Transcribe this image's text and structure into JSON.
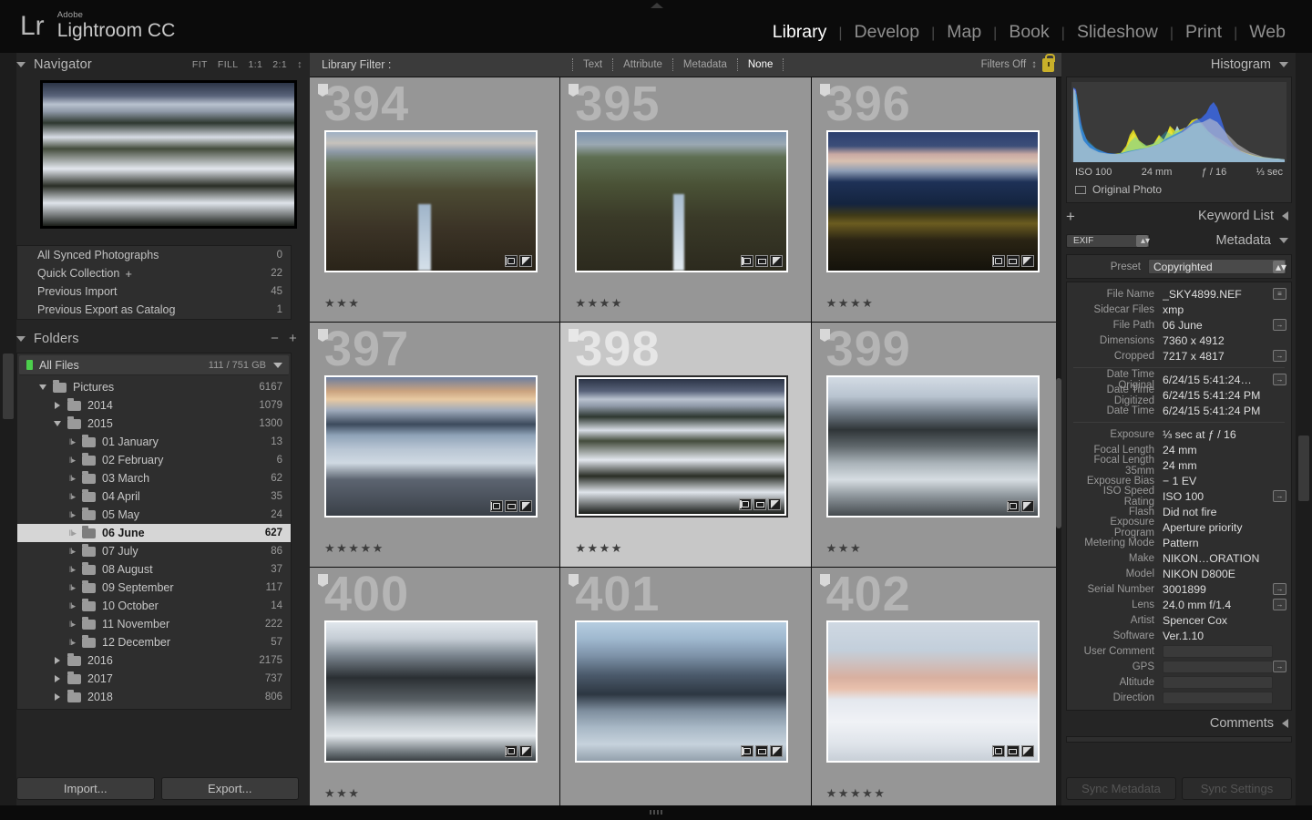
{
  "app": {
    "brand_prefix": "Lr",
    "brand_line1": "Adobe",
    "brand_line2": "Lightroom CC"
  },
  "modules": [
    {
      "label": "Library",
      "active": true
    },
    {
      "label": "Develop",
      "active": false
    },
    {
      "label": "Map",
      "active": false
    },
    {
      "label": "Book",
      "active": false
    },
    {
      "label": "Slideshow",
      "active": false
    },
    {
      "label": "Print",
      "active": false
    },
    {
      "label": "Web",
      "active": false
    }
  ],
  "navigator": {
    "title": "Navigator",
    "zoom_levels": [
      "FIT",
      "FILL",
      "1:1",
      "2:1"
    ]
  },
  "catalog": {
    "rows": [
      {
        "label": "All Synced Photographs",
        "count": "0"
      },
      {
        "label": "Quick Collection",
        "plus": "+",
        "count": "22"
      },
      {
        "label": "Previous Import",
        "count": "45"
      },
      {
        "label": "Previous Export as Catalog",
        "count": "1"
      }
    ]
  },
  "folders": {
    "title": "Folders",
    "minus": "−",
    "plus": "+",
    "volume": {
      "label": "All Files",
      "size": "111 / 751 GB"
    },
    "tree": [
      {
        "label": "Pictures",
        "count": "6167",
        "indent": 1,
        "disc": "down",
        "selected": false
      },
      {
        "label": "2014",
        "count": "1079",
        "indent": 2,
        "disc": "right",
        "selected": false
      },
      {
        "label": "2015",
        "count": "1300",
        "indent": 2,
        "disc": "down",
        "selected": false
      },
      {
        "label": "01 January",
        "count": "13",
        "indent": 3,
        "disc": "sub",
        "selected": false
      },
      {
        "label": "02 February",
        "count": "6",
        "indent": 3,
        "disc": "sub",
        "selected": false
      },
      {
        "label": "03 March",
        "count": "62",
        "indent": 3,
        "disc": "sub",
        "selected": false
      },
      {
        "label": "04 April",
        "count": "35",
        "indent": 3,
        "disc": "sub",
        "selected": false
      },
      {
        "label": "05 May",
        "count": "24",
        "indent": 3,
        "disc": "sub",
        "selected": false
      },
      {
        "label": "06 June",
        "count": "627",
        "indent": 3,
        "disc": "sub",
        "selected": true
      },
      {
        "label": "07 July",
        "count": "86",
        "indent": 3,
        "disc": "sub",
        "selected": false
      },
      {
        "label": "08 August",
        "count": "37",
        "indent": 3,
        "disc": "sub",
        "selected": false
      },
      {
        "label": "09 September",
        "count": "117",
        "indent": 3,
        "disc": "sub",
        "selected": false
      },
      {
        "label": "10 October",
        "count": "14",
        "indent": 3,
        "disc": "sub",
        "selected": false
      },
      {
        "label": "11 November",
        "count": "222",
        "indent": 3,
        "disc": "sub",
        "selected": false
      },
      {
        "label": "12 December",
        "count": "57",
        "indent": 3,
        "disc": "sub",
        "selected": false
      },
      {
        "label": "2016",
        "count": "2175",
        "indent": 2,
        "disc": "right",
        "selected": false
      },
      {
        "label": "2017",
        "count": "737",
        "indent": 2,
        "disc": "right",
        "selected": false
      },
      {
        "label": "2018",
        "count": "806",
        "indent": 2,
        "disc": "right",
        "selected": false
      }
    ]
  },
  "left_buttons": {
    "import": "Import...",
    "export": "Export..."
  },
  "library_filter": {
    "label": "Library Filter :",
    "tabs": [
      {
        "label": "Text",
        "active": false
      },
      {
        "label": "Attribute",
        "active": false
      },
      {
        "label": "Metadata",
        "active": false
      },
      {
        "label": "None",
        "active": true
      }
    ],
    "filters_off": "Filters Off"
  },
  "grid": {
    "cells": [
      {
        "number": "394",
        "stars": 3,
        "badges": [
          "crop",
          "adjust"
        ],
        "photo": "ph-canyon1",
        "selected": false
      },
      {
        "number": "395",
        "stars": 4,
        "badges": [
          "crop",
          "rect",
          "adjust"
        ],
        "photo": "ph-canyon2",
        "selected": false
      },
      {
        "number": "396",
        "stars": 4,
        "badges": [
          "crop",
          "rect",
          "adjust"
        ],
        "photo": "ph-sunset",
        "selected": false
      },
      {
        "number": "397",
        "stars": 5,
        "badges": [
          "crop",
          "rect",
          "adjust"
        ],
        "photo": "ph-snowmtn",
        "selected": false
      },
      {
        "number": "398",
        "stars": 4,
        "badges": [
          "crop",
          "rect",
          "adjust"
        ],
        "photo": "ph-snowfield",
        "selected": true
      },
      {
        "number": "399",
        "stars": 3,
        "badges": [
          "crop",
          "adjust"
        ],
        "photo": "ph-ice1",
        "selected": false
      },
      {
        "number": "400",
        "stars": 3,
        "badges": [
          "crop",
          "adjust"
        ],
        "photo": "ph-ice2",
        "selected": false
      },
      {
        "number": "401",
        "stars": 0,
        "badges": [
          "crop",
          "rect",
          "adjust"
        ],
        "photo": "ph-clouds",
        "selected": false
      },
      {
        "number": "402",
        "stars": 5,
        "badges": [
          "crop",
          "rect",
          "adjust"
        ],
        "photo": "ph-pinksnow",
        "selected": false
      }
    ]
  },
  "histogram": {
    "title": "Histogram",
    "iso": "ISO 100",
    "focal": "24 mm",
    "aperture": "ƒ / 16",
    "shutter": "⅓ sec",
    "original_photo": "Original Photo"
  },
  "keyword_list": {
    "title": "Keyword List",
    "plus": "+"
  },
  "metadata": {
    "title": "Metadata",
    "preset_mode": "EXIF",
    "preset_label": "Preset",
    "preset_value": "Copyrighted",
    "groups": [
      {
        "rows": [
          {
            "label": "File Name",
            "value": "_SKY4899.NEF",
            "action": "list"
          },
          {
            "label": "Sidecar Files",
            "value": "xmp",
            "action": "none"
          },
          {
            "label": "File Path",
            "value": "06 June",
            "action": "arrow"
          },
          {
            "label": "Dimensions",
            "value": "7360 x 4912",
            "action": "none"
          },
          {
            "label": "Cropped",
            "value": "7217 x 4817",
            "action": "arrow"
          }
        ]
      },
      {
        "rows": [
          {
            "label": "Date Time Original",
            "value": "6/24/15 5:41:24…",
            "action": "arrow"
          },
          {
            "label": "Date Time Digitized",
            "value": "6/24/15 5:41:24 PM",
            "action": "none"
          },
          {
            "label": "Date Time",
            "value": "6/24/15 5:41:24 PM",
            "action": "none"
          }
        ]
      },
      {
        "rows": [
          {
            "label": "Exposure",
            "value": "⅓ sec at ƒ / 16",
            "action": "none"
          },
          {
            "label": "Focal Length",
            "value": "24 mm",
            "action": "none"
          },
          {
            "label": "Focal Length 35mm",
            "value": "24 mm",
            "action": "none"
          },
          {
            "label": "Exposure Bias",
            "value": "− 1 EV",
            "action": "none"
          },
          {
            "label": "ISO Speed Rating",
            "value": "ISO 100",
            "action": "arrow"
          },
          {
            "label": "Flash",
            "value": "Did not fire",
            "action": "none"
          },
          {
            "label": "Exposure Program",
            "value": "Aperture priority",
            "action": "none"
          },
          {
            "label": "Metering Mode",
            "value": "Pattern",
            "action": "none"
          },
          {
            "label": "Make",
            "value": "NIKON…ORATION",
            "action": "none"
          },
          {
            "label": "Model",
            "value": "NIKON D800E",
            "action": "none"
          },
          {
            "label": "Serial Number",
            "value": "3001899",
            "action": "arrow"
          },
          {
            "label": "Lens",
            "value": "24.0 mm f/1.4",
            "action": "arrow"
          },
          {
            "label": "Artist",
            "value": "Spencer Cox",
            "action": "none"
          },
          {
            "label": "Software",
            "value": "Ver.1.10",
            "action": "none"
          },
          {
            "label": "User Comment",
            "value": "",
            "action": "none",
            "field": true
          },
          {
            "label": "GPS",
            "value": "",
            "action": "arrow",
            "field": true
          },
          {
            "label": "Altitude",
            "value": "",
            "action": "none",
            "field": true
          },
          {
            "label": "Direction",
            "value": "",
            "action": "none",
            "field": true
          }
        ]
      }
    ]
  },
  "comments": {
    "title": "Comments"
  },
  "right_buttons": {
    "sync_metadata": "Sync Metadata",
    "sync_settings": "Sync Settings"
  },
  "colors": {
    "panel_bg": "#252525",
    "cell_bg": "#969696",
    "cell_selected_bg": "#c7c7c7",
    "accent_lock": "#c9b02a",
    "volume_green": "#4ccf4c"
  }
}
